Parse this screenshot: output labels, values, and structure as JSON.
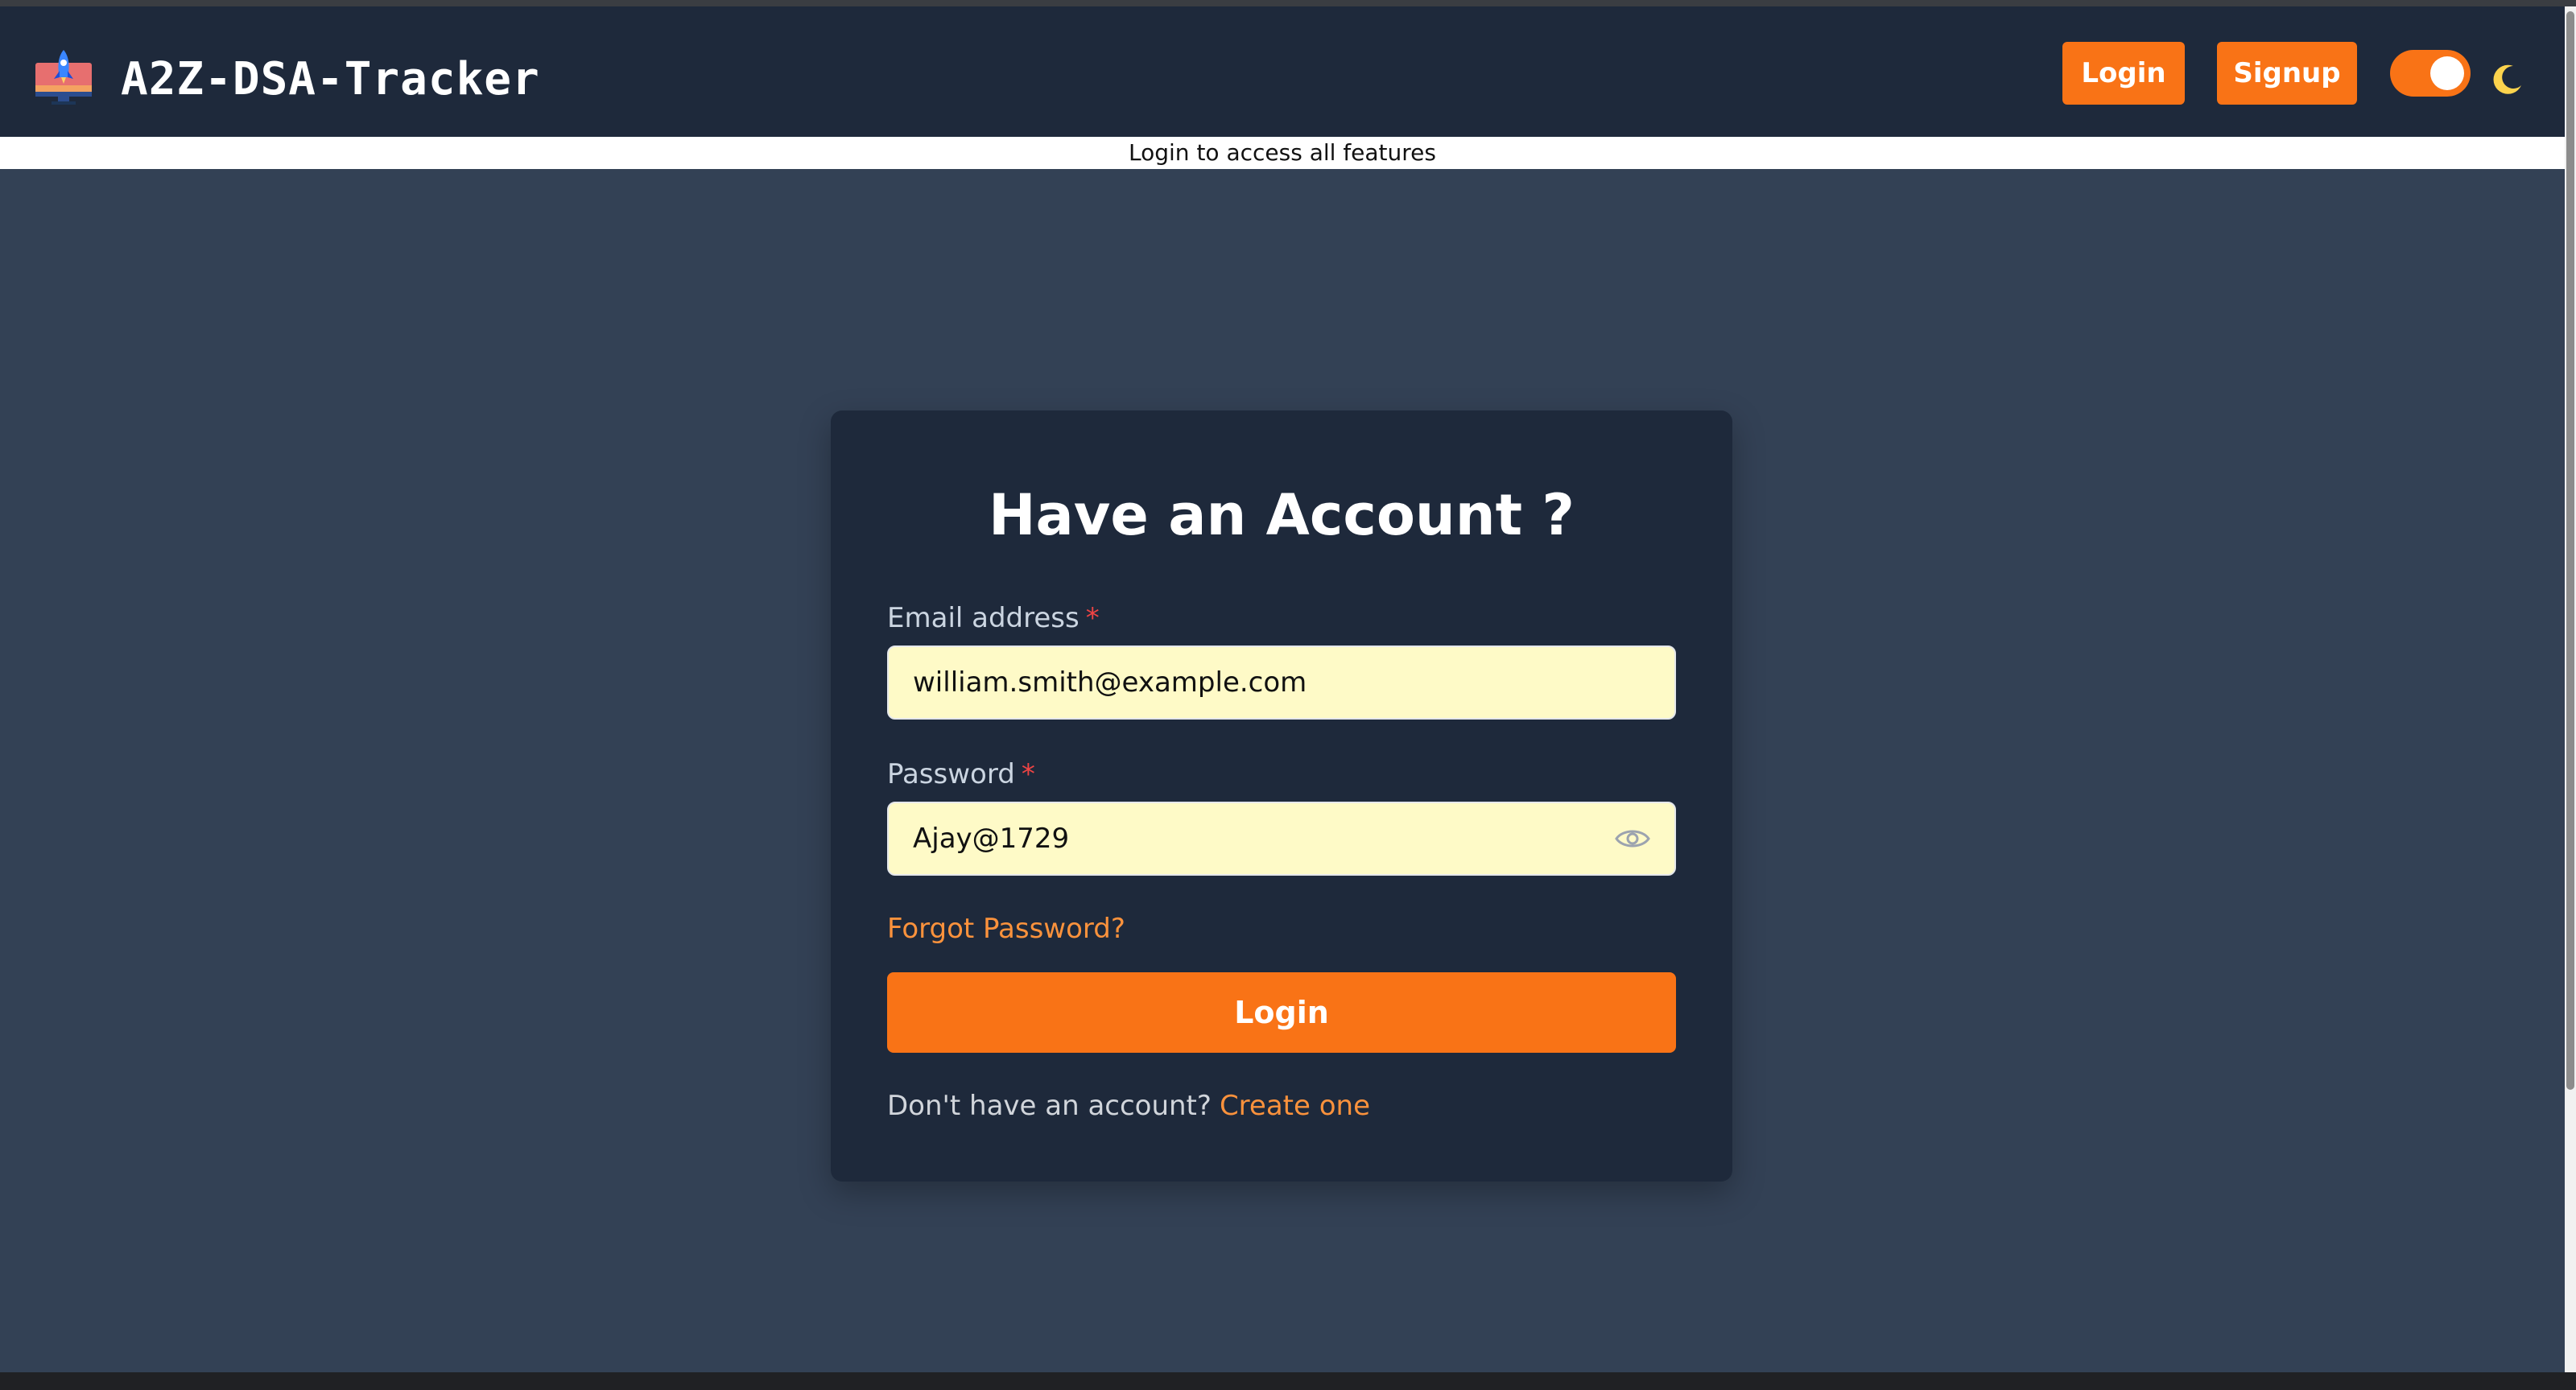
{
  "navbar": {
    "app_title": "A2Z-DSA-Tracker",
    "logo_icon": "rocket-monitor-icon",
    "login_label": "Login",
    "signup_label": "Signup",
    "theme_toggle_on": true,
    "theme_icon": "moon-icon"
  },
  "banner": {
    "text": "Login to access all features"
  },
  "login_card": {
    "title": "Have an Account ?",
    "email_label": "Email address",
    "email_value": "william.smith@example.com",
    "password_label": "Password",
    "password_value": "Ajay@1729",
    "required_marker": "*",
    "password_toggle_icon": "eye-icon",
    "forgot_password": "Forgot Password?",
    "submit_label": "Login",
    "no_account_text": "Don't have an account?",
    "create_link": "Create one"
  },
  "colors": {
    "accent": "#f97316",
    "navbar_bg": "#1e293b",
    "page_bg": "#334155",
    "card_bg": "#1e293b",
    "input_bg": "#fefac7",
    "link": "#fb923c",
    "required": "#ef4444"
  }
}
